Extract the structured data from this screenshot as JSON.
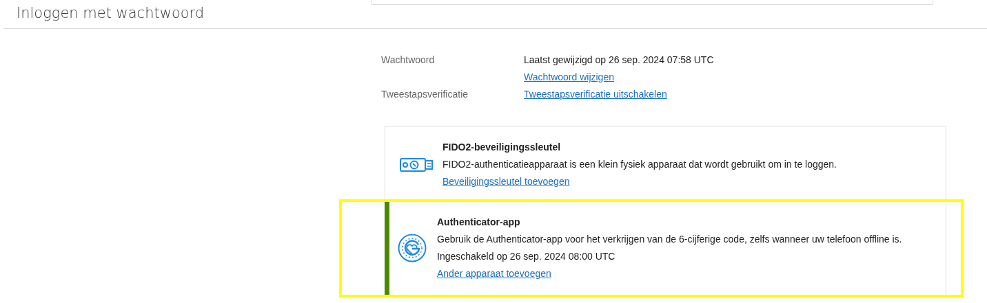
{
  "page": {
    "title": "Inloggen met wachtwoord"
  },
  "settings": [
    {
      "label": "Wachtwoord",
      "lines": [
        {
          "kind": "text",
          "text": "Laatst gewijzigd op 26 sep. 2024 07:58 UTC"
        },
        {
          "kind": "link",
          "text": "Wachtwoord wijzigen"
        }
      ]
    },
    {
      "label": "Tweestapsverificatie",
      "lines": [
        {
          "kind": "link",
          "text": "Tweestapsverificatie uitschakelen"
        }
      ]
    }
  ],
  "methods": [
    {
      "kind": "security-key",
      "title": "FIDO2-beveiligingssleutel",
      "description": "FIDO2-authenticatieapparaat is een klein fysiek apparaat dat wordt gebruikt om in te loggen.",
      "link": "Beveiligingssleutel toevoegen",
      "enabled": false,
      "highlighted": false
    },
    {
      "kind": "authenticator-app",
      "title": "Authenticator-app",
      "description": "Gebruik de Authenticator-app voor het verkrijgen van de 6-cijferige code, zelfs wanneer uw telefoon offline is.",
      "status": "Ingeschakeld op 26 sep. 2024 08:00 UTC",
      "link": "Ander apparaat toevoegen",
      "enabled": true,
      "highlighted": true
    }
  ]
}
